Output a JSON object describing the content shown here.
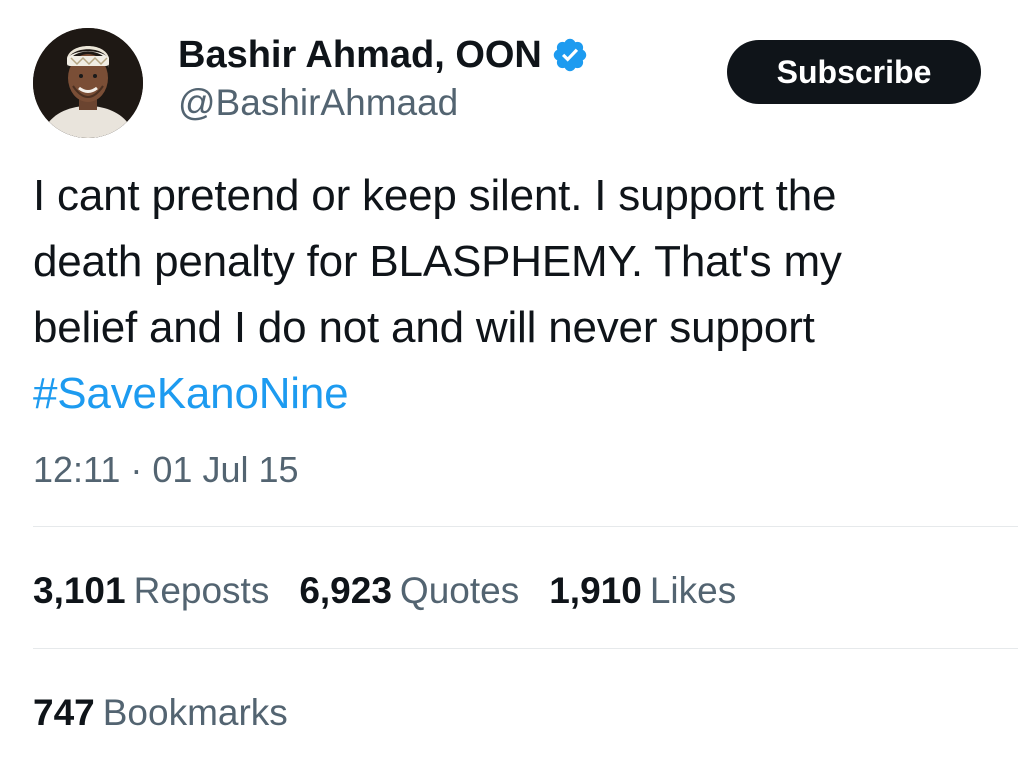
{
  "author": {
    "display_name": "Bashir Ahmad, OON",
    "handle": "@BashirAhmaad",
    "verified_icon": "verified-badge-icon"
  },
  "header": {
    "subscribe_label": "Subscribe"
  },
  "tweet": {
    "text_line1": "I cant pretend or keep silent. I support the",
    "text_line2": "death penalty for BLASPHEMY. That's my",
    "text_line3": "belief and I do not and will never support",
    "hashtag": "#SaveKanoNine",
    "timestamp": "12:11 · 01 Jul 15"
  },
  "stats": {
    "reposts_count": "3,101",
    "reposts_label": "Reposts",
    "quotes_count": "6,923",
    "quotes_label": "Quotes",
    "likes_count": "1,910",
    "likes_label": "Likes",
    "bookmarks_count": "747",
    "bookmarks_label": "Bookmarks"
  },
  "colors": {
    "text": "#0f1419",
    "secondary": "#536471",
    "link": "#1d9bf0",
    "verified": "#1d9bf0",
    "button_bg": "#0f1419",
    "divider": "#e6e9eb"
  }
}
